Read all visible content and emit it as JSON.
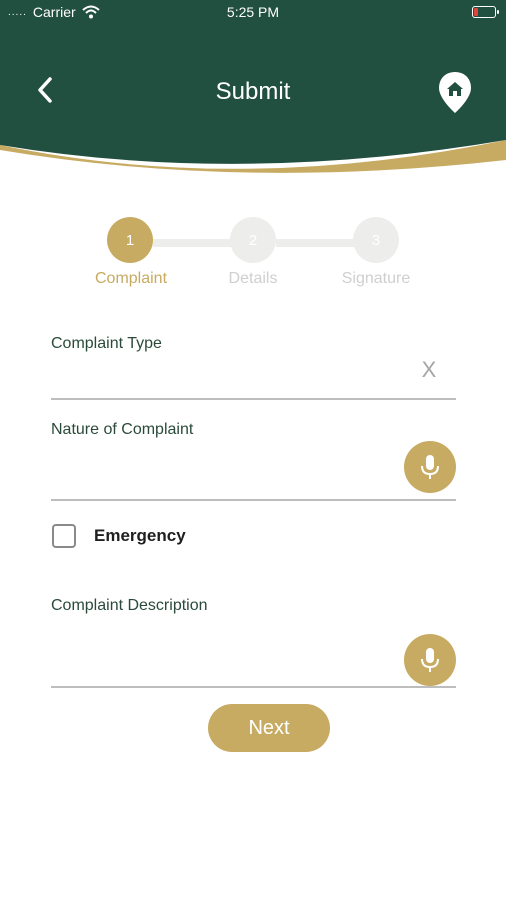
{
  "colors": {
    "header_green": "#225040",
    "accent_gold": "#c8ab62",
    "inactive_grey": "#ededeb",
    "battery_low": "#e0453a"
  },
  "status_bar": {
    "carrier": "Carrier",
    "time": "5:25 PM",
    "battery_level": 0.2
  },
  "header": {
    "title": "Submit",
    "back_icon": "chevron-left-icon",
    "home_icon": "home-location-pin-icon"
  },
  "stepper": {
    "active_step": 1,
    "steps": [
      {
        "number": "1",
        "label": "Complaint"
      },
      {
        "number": "2",
        "label": "Details"
      },
      {
        "number": "3",
        "label": "Signature"
      }
    ]
  },
  "form": {
    "complaint_type": {
      "label": "Complaint Type",
      "value": "",
      "clear_label": "X"
    },
    "nature_of_complaint": {
      "label": "Nature of Complaint",
      "value": ""
    },
    "emergency": {
      "label": "Emergency",
      "checked": false
    },
    "complaint_description": {
      "label": "Complaint Description",
      "value": ""
    }
  },
  "actions": {
    "next_label": "Next"
  }
}
